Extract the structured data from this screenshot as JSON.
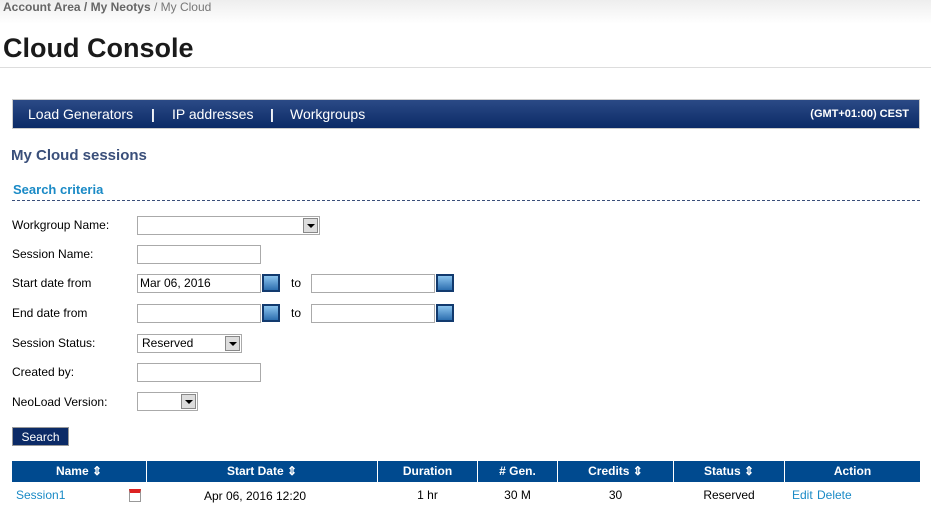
{
  "breadcrumb": {
    "items": [
      "Account Area",
      "My Neotys",
      "My Cloud"
    ],
    "sep": " / "
  },
  "title": "Cloud Console",
  "nav": {
    "items": [
      "Load Generators",
      "IP addresses",
      "Workgroups"
    ],
    "sep": "|",
    "timezone": "(GMT+01:00) CEST"
  },
  "section_title": "My Cloud sessions",
  "search": {
    "title": "Search criteria",
    "workgroup_label": "Workgroup Name:",
    "workgroup_value": "",
    "session_name_label": "Session Name:",
    "session_name_value": "",
    "start_label": "Start date from",
    "start_from": "Mar 06, 2016",
    "start_to": "",
    "end_label": "End date from",
    "end_from": "",
    "end_to": "",
    "to": "to",
    "status_label": "Session Status:",
    "status_value": "Reserved",
    "created_label": "Created by:",
    "created_value": "",
    "version_label": "NeoLoad Version:",
    "version_value": "",
    "button": "Search"
  },
  "table": {
    "headers": [
      "Name ⇕",
      "Start Date ⇕",
      "Duration",
      "# Gen.",
      "Credits ⇕",
      "Status ⇕",
      "Action"
    ],
    "rows": [
      {
        "name": "Session1",
        "start": "Apr 06, 2016 12:20",
        "duration": "1 hr",
        "gen": "30 M",
        "credits": "30",
        "status": "Reserved",
        "edit": "Edit",
        "delete": "Delete"
      }
    ]
  }
}
